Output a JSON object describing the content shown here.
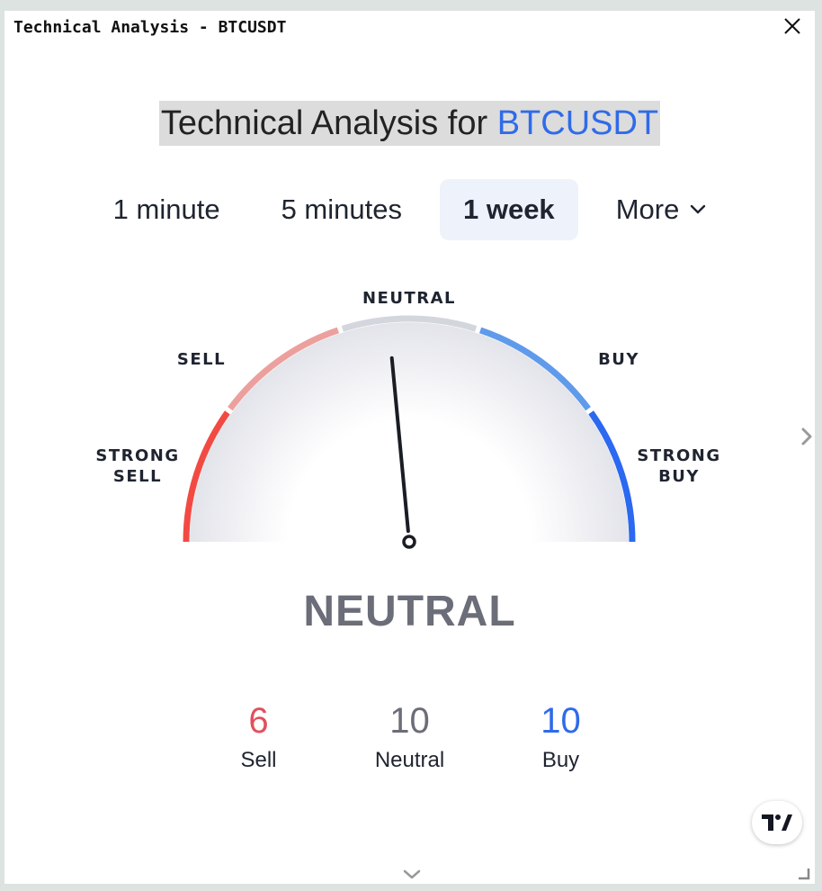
{
  "window": {
    "title": "Technical Analysis - BTCUSDT"
  },
  "heading": {
    "prefix": "Technical Analysis for ",
    "symbol": "BTCUSDT"
  },
  "tabs": [
    {
      "label": "1 minute",
      "active": false
    },
    {
      "label": "5 minutes",
      "active": false
    },
    {
      "label": "1 week",
      "active": true
    },
    {
      "label": "More",
      "active": false
    }
  ],
  "gauge": {
    "labels": {
      "strong_sell_1": "STRONG",
      "strong_sell_2": "SELL",
      "sell": "SELL",
      "neutral": "NEUTRAL",
      "buy": "BUY",
      "strong_buy_1": "STRONG",
      "strong_buy_2": "BUY"
    },
    "colors": {
      "strong_sell": "#f24a43",
      "sell": "#eca09e",
      "neutral": "#d4d6de",
      "buy": "#5f9bea",
      "strong_buy": "#2c68f0"
    },
    "needle_level": 0.47
  },
  "verdict": "NEUTRAL",
  "counts": [
    {
      "value": "6",
      "label": "Sell"
    },
    {
      "value": "10",
      "label": "Neutral"
    },
    {
      "value": "10",
      "label": "Buy"
    }
  ],
  "icons": {
    "close": "close-icon",
    "more": "chevron-down-icon",
    "logo": "tradingview-logo-icon",
    "next": "chevron-right-icon",
    "expand": "chevron-down-icon",
    "resize": "resize-icon"
  }
}
